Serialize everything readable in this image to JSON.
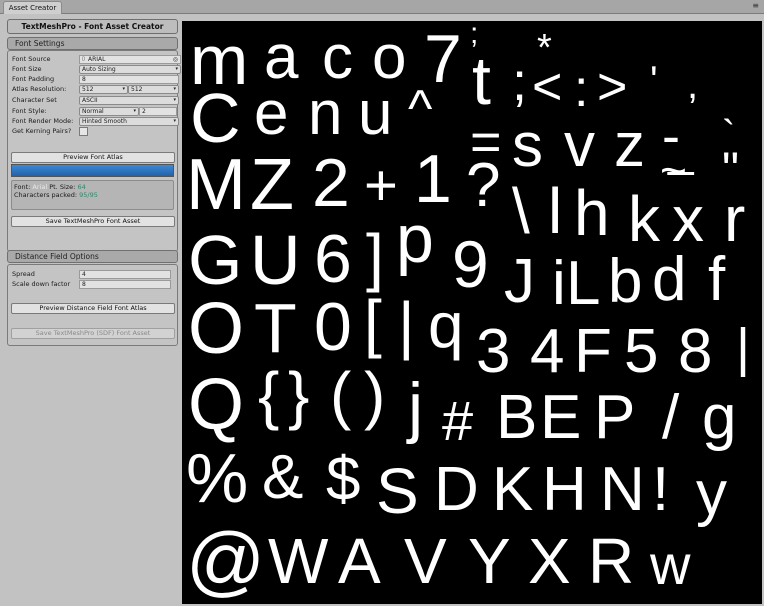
{
  "tab": {
    "label": "Asset Creator"
  },
  "title": "TextMeshPro - Font Asset Creator",
  "font_settings": {
    "header": "Font Settings",
    "font_source": {
      "label": "Font Source",
      "value": "ARIAL"
    },
    "font_size": {
      "label": "Font Size",
      "value": "Auto Sizing"
    },
    "font_padding": {
      "label": "Font Padding",
      "value": "8"
    },
    "atlas_resolution": {
      "label": "Atlas Resolution:",
      "width": "512",
      "height": "512"
    },
    "character_set": {
      "label": "Character Set",
      "value": "ASCII"
    },
    "font_style": {
      "label": "Font Style:",
      "value": "Normal",
      "amount": "2"
    },
    "font_render_mode": {
      "label": "Font Render Mode:",
      "value": "Hinted Smooth"
    },
    "kerning": {
      "label": "Get Kerning Pairs?",
      "checked": false
    },
    "preview_button": "Preview Font Atlas",
    "progress": 1.0,
    "stats": {
      "font_label": "Font:",
      "font_value": "Arial",
      "pt_label": "Pt. Size:",
      "pt_value": "64",
      "chars_label": "Characters packed:",
      "chars_value": "95/95"
    },
    "save_button": "Save TextMeshPro Font Asset"
  },
  "distance_field": {
    "header": "Distance Field Options",
    "spread": {
      "label": "Spread",
      "value": "4"
    },
    "scale_down": {
      "label": "Scale down factor",
      "value": "8"
    },
    "preview_button": "Preview Distance Field Font Atlas",
    "save_button": "Save TextMeshPro (SDF) Font Asset"
  },
  "atlas_glyphs": [
    "m",
    "a",
    "c",
    "o",
    "7",
    ";",
    "*",
    "t",
    ";",
    "<",
    ":",
    ">",
    "'",
    ",",
    "C",
    "e",
    "n",
    "u",
    "^",
    "=",
    "s",
    "v",
    "z",
    "-",
    "_",
    "`",
    "~",
    "\"",
    "M",
    "Z",
    "2",
    "+",
    "1",
    "?",
    "\\",
    "l",
    "h",
    "k",
    "x",
    "r",
    "G",
    "U",
    "6",
    "]",
    "p",
    "9",
    "J",
    "i",
    "L",
    "b",
    "d",
    "f",
    "O",
    "T",
    "0",
    "[",
    "|",
    "q",
    "3",
    "4",
    "F",
    "5",
    "8",
    "|",
    "Q",
    "{",
    "}",
    "(",
    ")",
    "j",
    "#",
    "B",
    "E",
    "P",
    "/",
    "g",
    "%",
    "&",
    "$",
    "S",
    "D",
    "K",
    "H",
    "N",
    "!",
    "y",
    "@",
    "W",
    "A",
    "V",
    "Y",
    "X",
    "R",
    "w"
  ]
}
